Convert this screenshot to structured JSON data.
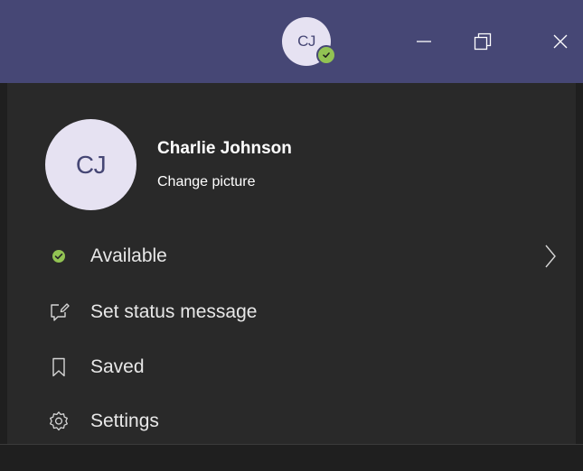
{
  "titlebar": {
    "avatar_initials": "CJ",
    "presence_status": "available"
  },
  "profile": {
    "initials": "CJ",
    "name": "Charlie Johnson",
    "change_picture_label": "Change picture"
  },
  "menu": {
    "items": [
      {
        "label": "Available",
        "icon": "available-status-icon"
      },
      {
        "label": "Set status message",
        "icon": "edit-message-icon"
      },
      {
        "label": "Saved",
        "icon": "bookmark-icon"
      },
      {
        "label": "Settings",
        "icon": "gear-icon"
      }
    ]
  },
  "colors": {
    "titlebar": "#464775",
    "panel": "#292929",
    "avatar_bg": "#e6e2f2",
    "presence_green": "#92c353"
  }
}
